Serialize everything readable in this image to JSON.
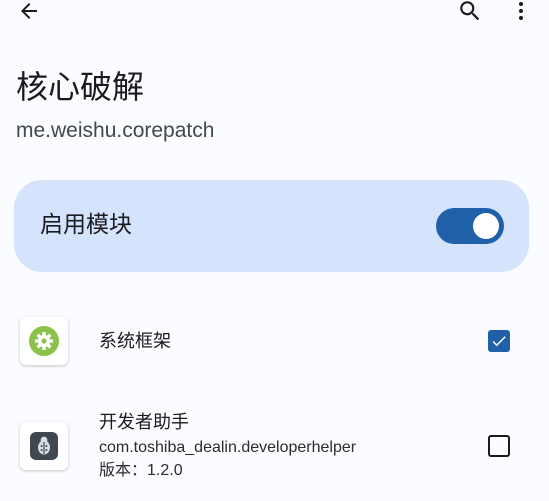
{
  "appbar": {
    "back_icon": "arrow-back-icon",
    "search_icon": "search-icon",
    "more_icon": "more-vert-icon"
  },
  "module": {
    "title": "核心破解",
    "package": "me.weishu.corepatch"
  },
  "enable_card": {
    "label": "启用模块",
    "enabled": true,
    "accent": "#1f60a8",
    "background": "#d5e3fc"
  },
  "scope": {
    "items": [
      {
        "title": "系统框架",
        "icon": "android-system-gear-icon",
        "checked": true
      },
      {
        "title": "开发者助手",
        "package": "com.toshiba_dealin.developerhelper",
        "version": "版本：1.2.0",
        "icon": "developer-helper-bug-icon",
        "checked": false
      }
    ]
  }
}
